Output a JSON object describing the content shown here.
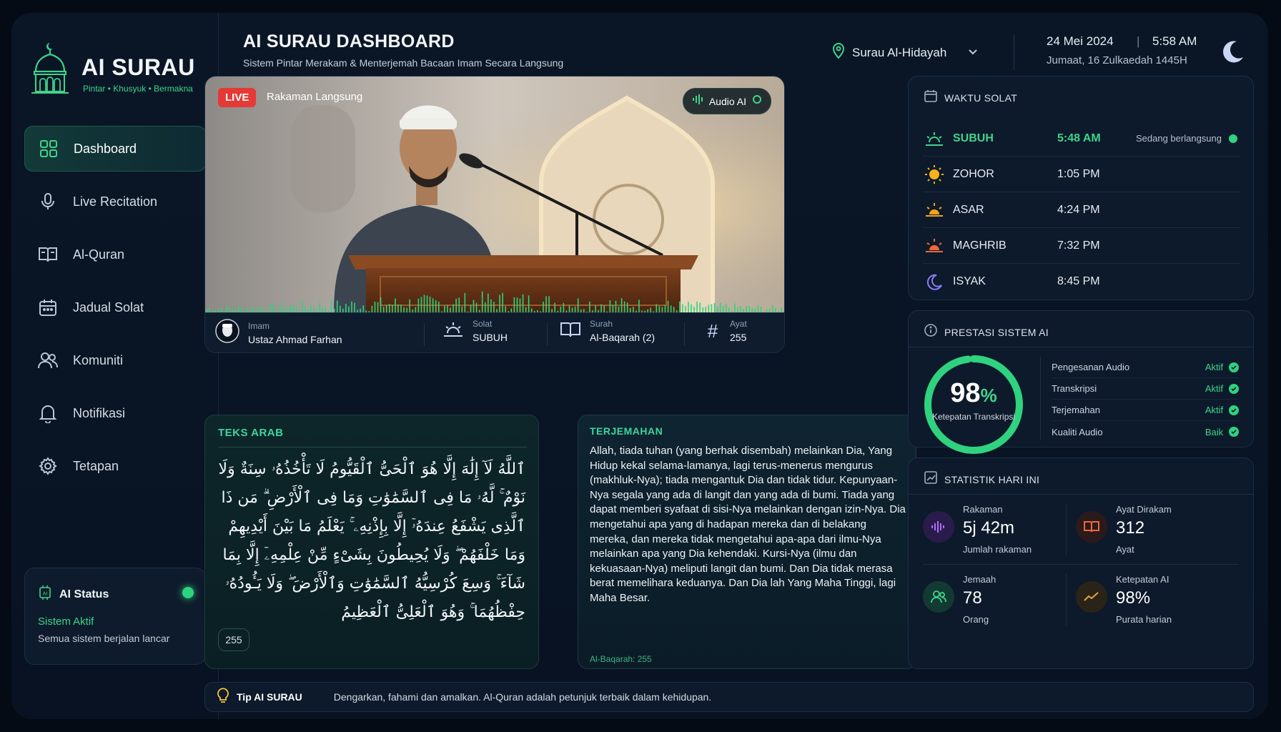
{
  "brand": {
    "name": "AI SURAU",
    "tagline": "Pintar • Khusyuk • Bermakna"
  },
  "header": {
    "title": "AI SURAU DASHBOARD",
    "subtitle": "Sistem Pintar Merakam & Menterjemah Bacaan Imam Secara Langsung",
    "location": "Surau Al-Hidayah",
    "date": "24 Mei 2024",
    "time": "5:58 AM",
    "hijri": "Jumaat, 16 Zulkaedah 1445H"
  },
  "nav": [
    {
      "label": "Dashboard",
      "icon": "grid-icon",
      "active": true
    },
    {
      "label": "Live Recitation",
      "icon": "microphone-icon"
    },
    {
      "label": "Al-Quran",
      "icon": "book-icon"
    },
    {
      "label": "Jadual Solat",
      "icon": "calendar-icon"
    },
    {
      "label": "Komuniti",
      "icon": "users-icon"
    },
    {
      "label": "Notifikasi",
      "icon": "bell-icon"
    },
    {
      "label": "Tetapan",
      "icon": "gear-icon"
    }
  ],
  "ai_status": {
    "title": "AI Status",
    "status": "Sistem Aktif",
    "note": "Semua sistem berjalan lancar"
  },
  "video": {
    "live_label": "LIVE",
    "live_text": "Rakaman Langsung",
    "audio_label": "Audio AI",
    "info": {
      "imam_key": "Imam",
      "imam": "Ustaz Ahmad Farhan",
      "solat_key": "Solat",
      "solat": "SUBUH",
      "surah_key": "Surah",
      "surah": "Al-Baqarah (2)",
      "ayat_key": "Ayat",
      "ayat": "255"
    }
  },
  "arab_panel": {
    "title": "TEKS ARAB",
    "text": "ٱللَّهُ لَآ إِلَٰهَ إِلَّا هُوَ ٱلْحَىُّ ٱلْقَيُّومُ لَا تَأْخُذُهُۥ سِنَةٌ وَلَا نَوْمٌ ۚ لَّهُۥ مَا فِى ٱلسَّمَٰوَٰتِ وَمَا فِى ٱلْأَرْضِ ۗ مَن ذَا ٱلَّذِى يَشْفَعُ عِندَهُۥٓ إِلَّا بِإِذْنِهِۦ ۚ يَعْلَمُ مَا بَيْنَ أَيْدِيهِمْ وَمَا خَلْفَهُمْ ۖ وَلَا يُحِيطُونَ بِشَىْءٍ مِّنْ عِلْمِهِۦٓ إِلَّا بِمَا شَآءَ ۚ وَسِعَ كُرْسِيُّهُ ٱلسَّمَٰوَٰتِ وَٱلْأَرْضَ ۖ وَلَا يَـُٔودُهُۥ حِفْظُهُمَا ۚ وَهُوَ ٱلْعَلِىُّ ٱلْعَظِيمُ",
    "ayat_badge": "255"
  },
  "translation_panel": {
    "title": "TERJEMAHAN",
    "text": "Allah, tiada tuhan (yang berhak disembah) melainkan Dia, Yang Hidup kekal selama-lamanya, lagi terus-menerus mengurus (makhluk-Nya); tiada mengantuk Dia dan tidak tidur. Kepunyaan-Nya segala yang ada di langit dan yang ada di bumi. Tiada yang dapat memberi syafaat di sisi-Nya melainkan dengan izin-Nya. Dia mengetahui apa yang di hadapan mereka dan di belakang mereka, dan mereka tidak mengetahui apa-apa dari ilmu-Nya melainkan apa yang Dia kehendaki. Kursi-Nya (ilmu dan kekuasaan-Nya) meliputi langit dan bumi. Dan Dia tidak merasa berat memelihara keduanya. Dan Dia lah Yang Maha Tinggi, lagi Maha Besar.",
    "reference": "Al-Baqarah: 255"
  },
  "prayer": {
    "title": "WAKTU SOLAT",
    "rows": [
      {
        "name": "SUBUH",
        "time": "5:48 AM",
        "status": "Sedang berlangsung",
        "current": true
      },
      {
        "name": "ZOHOR",
        "time": "1:05 PM"
      },
      {
        "name": "ASAR",
        "time": "4:24 PM"
      },
      {
        "name": "MAGHRIB",
        "time": "7:32 PM"
      },
      {
        "name": "ISYAK",
        "time": "8:45 PM"
      }
    ]
  },
  "performance": {
    "title": "PRESTASI SISTEM AI",
    "value": "98",
    "unit": "%",
    "percent": 98,
    "label": "Ketepatan Transkripsi",
    "metrics": [
      {
        "name": "Pengesanan Audio",
        "status": "Aktif"
      },
      {
        "name": "Transkripsi",
        "status": "Aktif"
      },
      {
        "name": "Terjemahan",
        "status": "Aktif"
      },
      {
        "name": "Kualiti Audio",
        "status": "Baik"
      }
    ]
  },
  "stats": {
    "title": "STATISTIK HARI INI",
    "items": [
      {
        "key": "Rakaman",
        "value": "5j 42m",
        "unit": "Jumlah rakaman"
      },
      {
        "key": "Ayat Dirakam",
        "value": "312",
        "unit": "Ayat"
      },
      {
        "key": "Jemaah",
        "value": "78",
        "unit": "Orang"
      },
      {
        "key": "Ketepatan AI",
        "value": "98%",
        "unit": "Purata harian"
      }
    ]
  },
  "tip": {
    "title": "Tip AI SURAU",
    "text": "Dengarkan, fahami dan amalkan. Al-Quran adalah petunjuk terbaik dalam kehidupan."
  },
  "colors": {
    "accent": "#3fd48a",
    "live": "#e53935",
    "background": "#081222"
  }
}
